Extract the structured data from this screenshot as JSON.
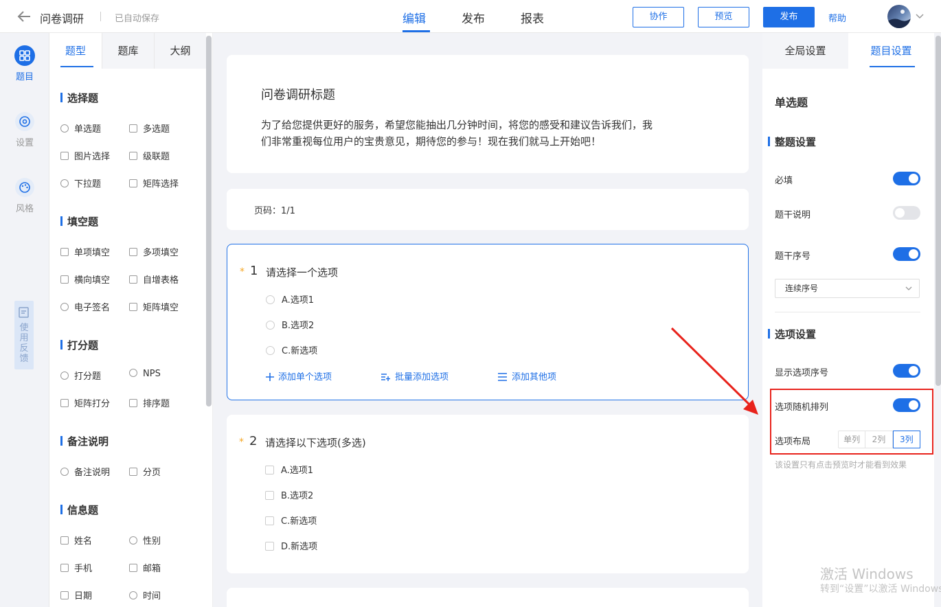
{
  "header": {
    "title": "问卷调研",
    "autosave": "已自动保存",
    "tabs": [
      "编辑",
      "发布",
      "报表"
    ],
    "active_tab": "编辑",
    "btn_collab": "协作",
    "btn_preview": "预览",
    "btn_publish": "发布",
    "help": "帮助"
  },
  "rail": {
    "items": [
      {
        "label": "题目",
        "icon": "grid-icon"
      },
      {
        "label": "设置",
        "icon": "gear-icon"
      },
      {
        "label": "风格",
        "icon": "palette-icon"
      }
    ],
    "feedback": "使用反馈"
  },
  "types_panel": {
    "tabs": [
      "题型",
      "题库",
      "大纲"
    ],
    "groups": [
      {
        "title": "选择题",
        "items": [
          "单选题",
          "多选题",
          "图片选择",
          "级联题",
          "下拉题",
          "矩阵选择"
        ]
      },
      {
        "title": "填空题",
        "items": [
          "单项填空",
          "多项填空",
          "横向填空",
          "自增表格",
          "电子签名",
          "矩阵填空"
        ]
      },
      {
        "title": "打分题",
        "items": [
          "打分题",
          "NPS",
          "矩阵打分",
          "排序题"
        ]
      },
      {
        "title": "备注说明",
        "items": [
          "备注说明",
          "分页"
        ]
      },
      {
        "title": "信息题",
        "items": [
          "姓名",
          "性别",
          "手机",
          "邮箱",
          "日期",
          "时间"
        ]
      }
    ]
  },
  "canvas": {
    "survey_title": "问卷调研标题",
    "survey_desc": "为了给您提供更好的服务，希望您能抽出几分钟时间，将您的感受和建议告诉我们，我们非常重视每位用户的宝贵意见，期待您的参与！现在我们就马上开始吧！",
    "page_label": "页码：1/1",
    "questions": [
      {
        "num": "1",
        "text": "请选择一个选项",
        "type": "radio",
        "options": [
          "A.选项1",
          "B.选项2",
          "C.新选项"
        ]
      },
      {
        "num": "2",
        "text": "请选择以下选项(多选)",
        "type": "checkbox",
        "options": [
          "A.选项1",
          "B.选项2",
          "C.新选项",
          "D.新选项"
        ]
      }
    ],
    "actions": [
      "添加单个选项",
      "批量添加选项",
      "添加其他项"
    ]
  },
  "settings": {
    "tabs": [
      "全局设置",
      "题目设置"
    ],
    "question_type": "单选题",
    "section_whole": "整题设置",
    "required": "必填",
    "required_on": true,
    "stem_desc": "题干说明",
    "stem_desc_on": false,
    "stem_num": "题干序号",
    "stem_num_on": true,
    "numbering_select": "连续序号",
    "section_options": "选项设置",
    "show_option_num": "显示选项序号",
    "show_option_num_on": true,
    "random_order": "选项随机排列",
    "random_order_on": true,
    "layout_label": "选项布局",
    "layout_options": [
      "单列",
      "2列",
      "3列"
    ],
    "layout_selected": "3列",
    "hint": "该设置只有点击预览时才能看到效果"
  },
  "annotation_color": "#e8231c",
  "accent": "#1e6fe6",
  "watermark": {
    "line1": "激活 Windows",
    "line2": "转到“设置”以激活 Windows"
  }
}
